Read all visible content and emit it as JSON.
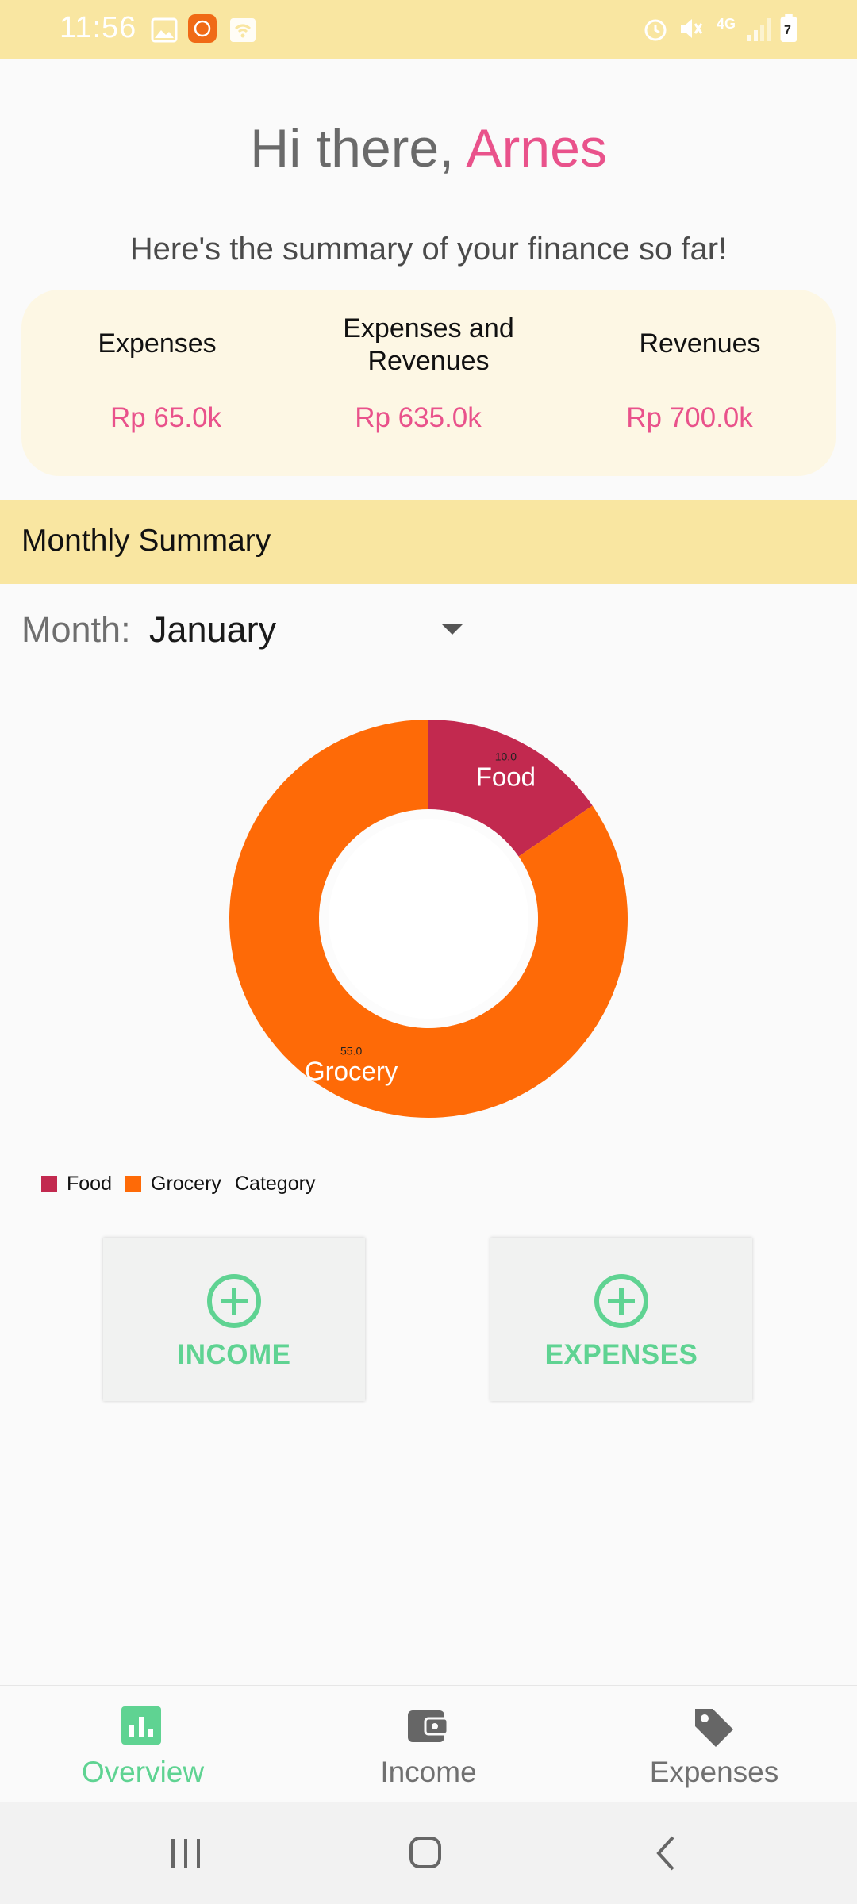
{
  "status_bar": {
    "time": "11:56",
    "icons_left": [
      "gallery-icon",
      "app-notification-icon",
      "wifi-icon"
    ],
    "icons_right": [
      "alarm-icon",
      "mute-icon",
      "4g-icon",
      "signal-icon",
      "battery-icon"
    ],
    "battery": "7",
    "network": "4G"
  },
  "header": {
    "greeting": "Hi there, ",
    "name": "Arnes",
    "subtitle": "Here's the summary of your finance so far!"
  },
  "summary": {
    "expenses_label": "Expenses",
    "expenses_value": "Rp 65.0k",
    "balance_label_line1": "Expenses and",
    "balance_label_line2": "Revenues",
    "balance_value": "Rp 635.0k",
    "revenues_label": "Revenues",
    "revenues_value": "Rp 700.0k"
  },
  "monthly": {
    "title": "Monthly Summary",
    "month_label": "Month:",
    "month_value": "January"
  },
  "chart_data": {
    "type": "pie",
    "hole": true,
    "categories": [
      "Food",
      "Grocery"
    ],
    "values": [
      10.0,
      55.0
    ],
    "value_labels": [
      "10.0",
      "55.0"
    ],
    "colors": [
      "#c2294f",
      "#fe6a07"
    ],
    "legend": [
      "Food",
      "Grocery"
    ],
    "legend_title": "Category",
    "legend_placement": "bottom-left"
  },
  "actions": {
    "income_label": "INCOME",
    "expenses_label": "EXPENSES",
    "accent": "#5fd392"
  },
  "bottom_nav": {
    "items": [
      {
        "label": "Overview",
        "icon": "bar-chart-icon",
        "active": true
      },
      {
        "label": "Income",
        "icon": "wallet-icon",
        "active": false
      },
      {
        "label": "Expenses",
        "icon": "tag-icon",
        "active": false
      }
    ]
  },
  "colors": {
    "accent_pink": "#e9528b",
    "header_yellow": "#f9e6a1",
    "card_cream": "#fdf7e4",
    "accent_green": "#5fd392"
  }
}
